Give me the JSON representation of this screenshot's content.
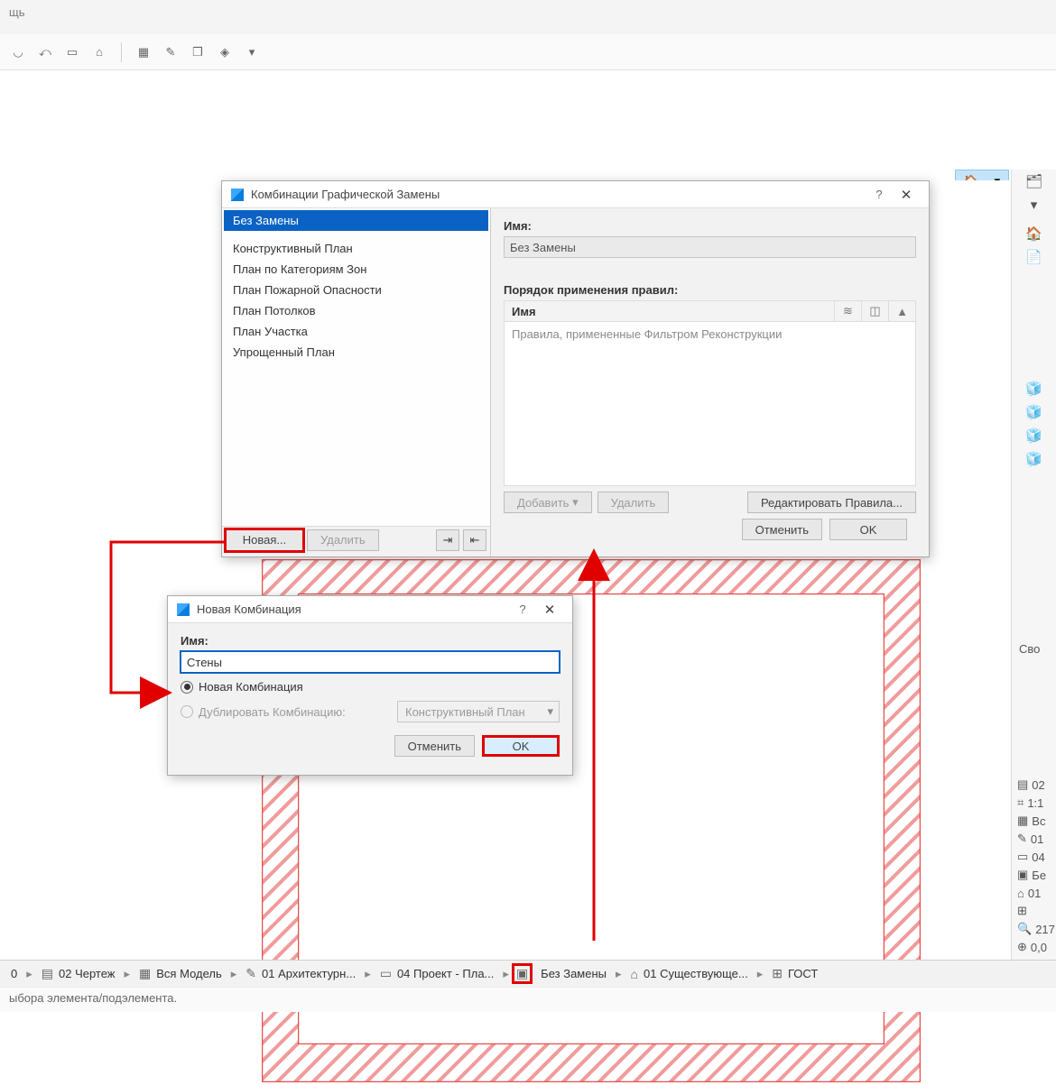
{
  "menu": {
    "help": "щь"
  },
  "mainDialog": {
    "title": "Комбинации Графической Замены",
    "combos": [
      "Без Замены",
      "Конструктивный План",
      "План по Категориям Зон",
      "План Пожарной Опасности",
      "План Потолков",
      "План Участка",
      "Упрощенный План"
    ],
    "selectedIndex": 0,
    "btnNew": "Новая...",
    "btnDelete": "Удалить",
    "nameLabel": "Имя:",
    "nameValue": "Без Замены",
    "rulesLabel": "Порядок применения правил:",
    "rulesColName": "Имя",
    "rulesPlaceholder": "Правила, примененные Фильтром Реконструкции",
    "btnAdd": "Добавить",
    "btnRemove": "Удалить",
    "btnEditRules": "Редактировать Правила...",
    "btnCancel": "Отменить",
    "btnOK": "OK"
  },
  "newDialog": {
    "title": "Новая Комбинация",
    "nameLabel": "Имя:",
    "nameValue": "Стены",
    "optNew": "Новая Комбинация",
    "optDup": "Дублировать Комбинацию:",
    "dupValue": "Конструктивный План",
    "btnCancel": "Отменить",
    "btnOK": "OK"
  },
  "crumbs": {
    "c0": "0",
    "c1": "02 Чертеж",
    "c2": "Вся Модель",
    "c3": "01 Архитектурн...",
    "c4": "04 Проект - Пла...",
    "c5": "Без Замены",
    "c6": "01 Существующе...",
    "c7": "ГОСТ"
  },
  "status": "ыбора элемента/подэлемента.",
  "rightMini": {
    "r0": "02",
    "r1": "1:1",
    "r2": "Вс",
    "r3": "01",
    "r4": "04",
    "r5": "Бе",
    "r6": "01",
    "r7": "217",
    "r8": "0,0"
  },
  "rightProps": "Сво"
}
